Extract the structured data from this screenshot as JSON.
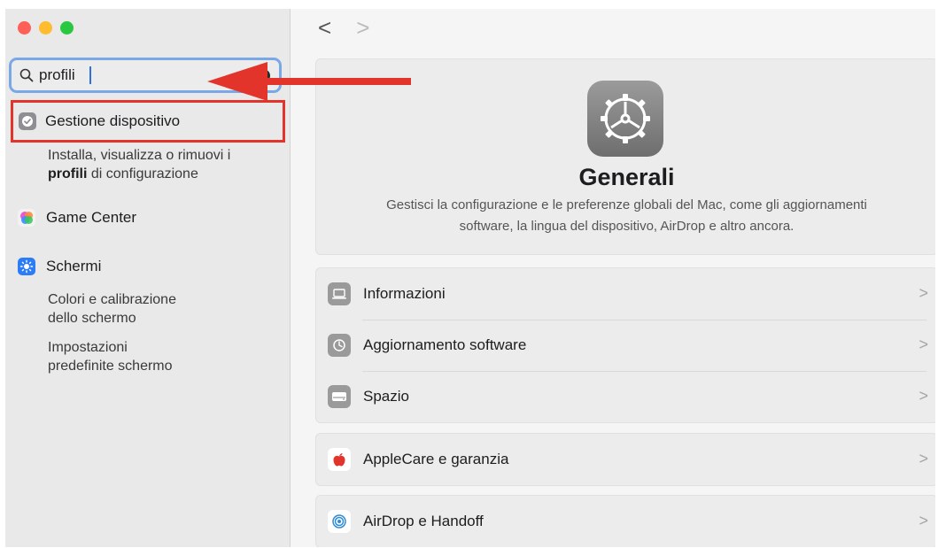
{
  "sidebar": {
    "search": {
      "value": "profili"
    },
    "results": [
      {
        "label": "Gestione dispositivo",
        "icon": "checkmark-badge-icon",
        "sub": [
          {
            "pre": "Installa, visualizza o rimuovi i",
            "bold": "profili",
            "post": " di configurazione"
          }
        ]
      },
      {
        "label": "Game Center",
        "icon": "game-center-icon"
      },
      {
        "label": "Schermi",
        "icon": "sun-icon",
        "sub": [
          "Colori e calibrazione",
          "dello schermo",
          "Impostazioni",
          "predefinite schermo"
        ]
      }
    ]
  },
  "nav": {
    "back": "<",
    "forward": ">"
  },
  "hero": {
    "title": "Generali",
    "desc_line1": "Gestisci la configurazione e le preferenze globali del Mac, come gli aggiornamenti",
    "desc_line2": "software, la lingua del dispositivo, AirDrop e altro ancora."
  },
  "settings": {
    "group1": [
      "Informazioni",
      "Aggiornamento software",
      "Spazio"
    ],
    "group2": [
      "AppleCare e garanzia"
    ],
    "group3": [
      "AirDrop e Handoff"
    ]
  },
  "chevron": ">",
  "colors": {
    "highlight": "#e2342a",
    "search_focus": "#7aa8e6",
    "accent": "#2f6fe0"
  }
}
